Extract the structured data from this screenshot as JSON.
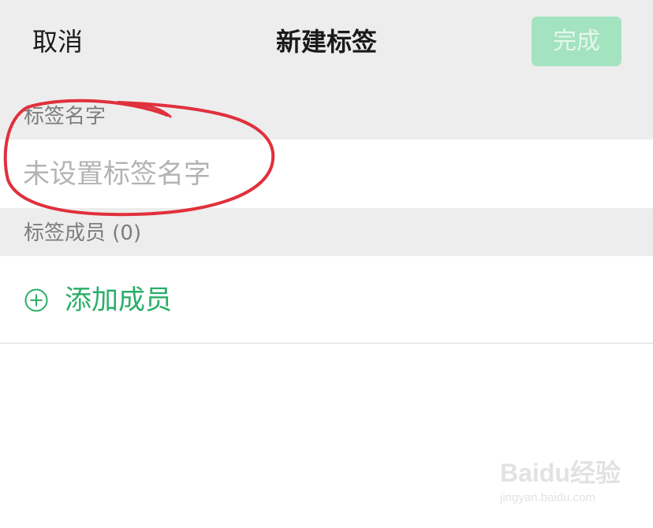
{
  "nav": {
    "cancel_label": "取消",
    "title": "新建标签",
    "done_label": "完成"
  },
  "tag_name_section": {
    "header": "标签名字",
    "input_value": "",
    "input_placeholder": "未设置标签名字"
  },
  "members_section": {
    "header": "标签成员 (0)",
    "add_member_label": "添加成员"
  },
  "icons": {
    "add_member": "plus-circle-icon"
  },
  "colors": {
    "accent_green": "#2aae67",
    "done_button_disabled": "#a3e3bf",
    "annotation_red": "#e0303c"
  },
  "watermark": {
    "brand": "Baidu经验",
    "url": "jingyan.baidu.com"
  }
}
